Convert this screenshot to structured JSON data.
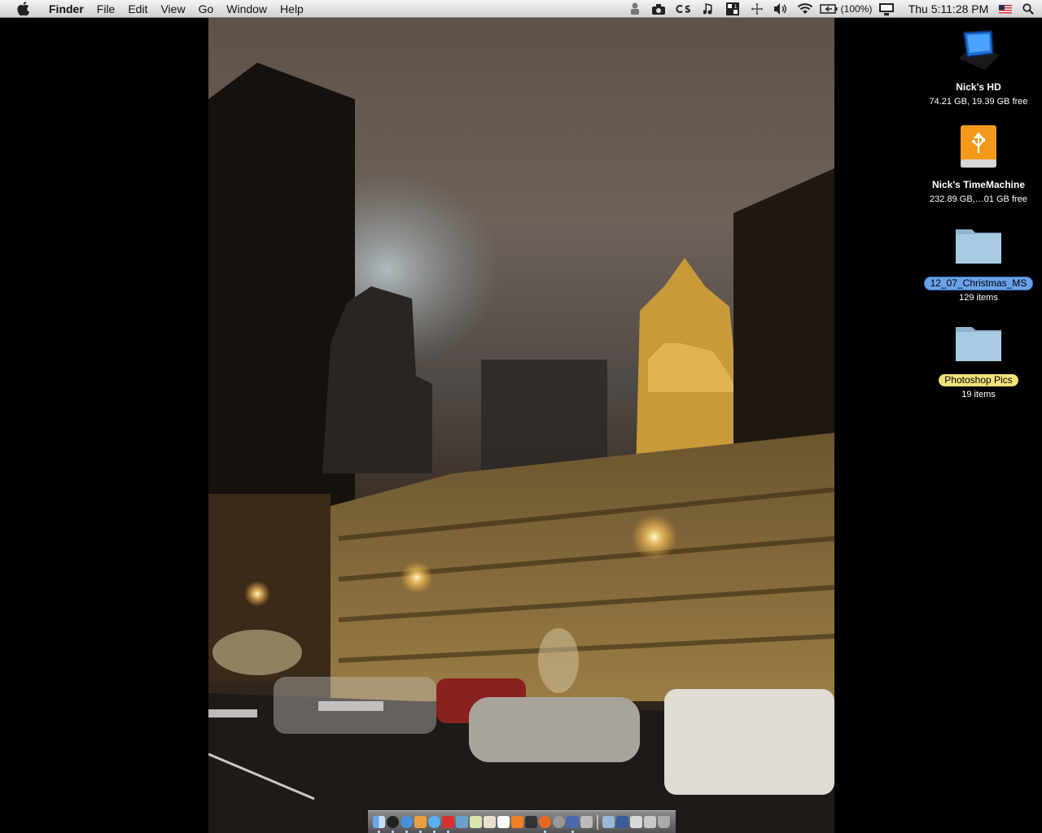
{
  "menubar": {
    "app_name": "Finder",
    "menus": [
      "File",
      "Edit",
      "View",
      "Go",
      "Window",
      "Help"
    ],
    "status_icons": [
      "accessibility-icon",
      "camera-icon",
      "cs-icon",
      "music-note-icon",
      "spaces-icon",
      "expose-icon",
      "volume-icon",
      "wifi-icon",
      "battery-icon"
    ],
    "battery_text": "(100%)",
    "clock": "Thu 5:11:28 PM",
    "flag_icon": "us-flag-icon",
    "search_icon": "spotlight-icon"
  },
  "desktop": {
    "icons": [
      {
        "name": "Nick's HD",
        "info": "74.21 GB, 19.39 GB free",
        "icon": "hard-drive-icon"
      },
      {
        "name": "Nick's TimeMachine",
        "info": "232.89 GB,…01 GB free",
        "icon": "usb-drive-icon"
      },
      {
        "name": "12_07_Christmas_MS",
        "info": "129 items",
        "icon": "folder-icon",
        "label_color": "#6aa2e8"
      },
      {
        "name": "Photoshop Pics",
        "info": "19 items",
        "icon": "folder-icon",
        "label_color": "#f3e27a"
      }
    ]
  },
  "dock": {
    "items": [
      "finder-icon",
      "dashboard-icon",
      "safari-icon",
      "adium-icon",
      "itunes-icon",
      "photo-booth-icon",
      "iphoto-icon",
      "preview-icon",
      "textedit-icon",
      "ical-icon",
      "vlc-icon",
      "terminal-icon",
      "firefox-icon",
      "system-preferences-icon",
      "xcode-icon",
      "trash-app-icon",
      "folder-stack-icon",
      "downloads-stack-icon",
      "documents-stack-icon",
      "mail-stack-icon",
      "trash-icon"
    ]
  },
  "colors": {
    "menubar_bg": "#e4e4e4",
    "selection_blue": "#6aa2e8",
    "selection_yellow": "#f3e27a"
  }
}
